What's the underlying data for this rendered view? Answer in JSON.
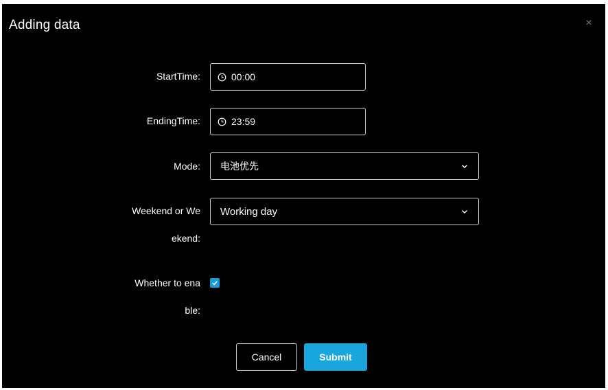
{
  "dialog": {
    "title": "Adding data",
    "close_glyph": "×"
  },
  "form": {
    "start_time": {
      "label": "StartTime:",
      "value": "00:00",
      "icon": "clock-icon"
    },
    "ending_time": {
      "label": "EndingTime:",
      "value": "23:59",
      "icon": "clock-icon"
    },
    "mode": {
      "label": "Mode:",
      "value": "电池优先",
      "icon": "chevron-down-icon"
    },
    "day_type": {
      "label_line1": "Weekend or We",
      "label_line2": "ekend:",
      "value": "Working day",
      "icon": "chevron-down-icon"
    },
    "enable": {
      "label_line1": "Whether to ena",
      "label_line2": "ble:",
      "checked": true
    }
  },
  "buttons": {
    "cancel": "Cancel",
    "submit": "Submit"
  },
  "colors": {
    "background": "#000000",
    "accent": "#18a6dc",
    "border": "#cfcfcf",
    "text": "#ffffff"
  }
}
